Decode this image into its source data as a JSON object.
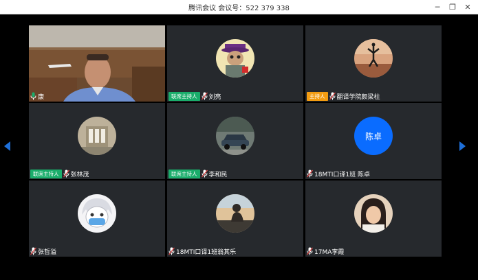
{
  "window": {
    "title": "腾讯会议  会议号：522 379 338",
    "controls": [
      "minimize",
      "restore",
      "close"
    ]
  },
  "participants": [
    {
      "name": "康",
      "role": "",
      "video": "camera",
      "avatar_icon": "person-video-icon"
    },
    {
      "name": "刘亮",
      "role": "联席主持人",
      "avatar_icon": "cartoon-avatar-icon"
    },
    {
      "name": "翻译学院颜梁柱",
      "role": "主持人",
      "avatar_icon": "sunset-jump-avatar-icon"
    },
    {
      "name": "张林茂",
      "role": "联席主持人",
      "avatar_icon": "building-avatar-icon"
    },
    {
      "name": "李和民",
      "role": "联席主持人",
      "avatar_icon": "car-avatar-icon"
    },
    {
      "name": "18MTI口译1班 陈卓",
      "role": "",
      "avatar_text": "陈卓"
    },
    {
      "name": "张哲溢",
      "role": "",
      "avatar_icon": "anime-mask-avatar-icon"
    },
    {
      "name": "18MTI口译1班翁其乐",
      "role": "",
      "avatar_icon": "sunset-person-avatar-icon"
    },
    {
      "name": "17MA李霞",
      "role": "",
      "avatar_icon": "girl-photo-avatar-icon"
    }
  ],
  "colors": {
    "cohost_badge": "#1aad6b",
    "host_badge": "#f39c12",
    "text_avatar": "#0a6cff",
    "nav_arrow": "#1e6fd9"
  }
}
